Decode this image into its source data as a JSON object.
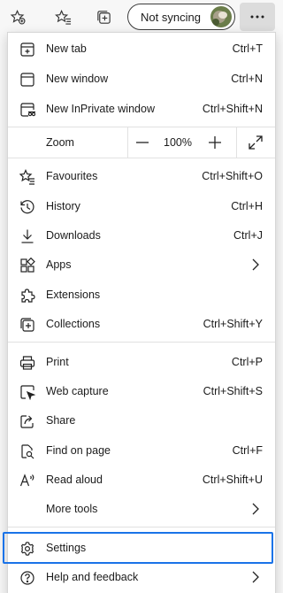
{
  "toolbar": {
    "sync_label": "Not syncing"
  },
  "menu": {
    "new_tab": {
      "label": "New tab",
      "shortcut": "Ctrl+T"
    },
    "new_window": {
      "label": "New window",
      "shortcut": "Ctrl+N"
    },
    "new_inprivate": {
      "label": "New InPrivate window",
      "shortcut": "Ctrl+Shift+N"
    },
    "zoom": {
      "label": "Zoom",
      "value": "100%"
    },
    "favourites": {
      "label": "Favourites",
      "shortcut": "Ctrl+Shift+O"
    },
    "history": {
      "label": "History",
      "shortcut": "Ctrl+H"
    },
    "downloads": {
      "label": "Downloads",
      "shortcut": "Ctrl+J"
    },
    "apps": {
      "label": "Apps"
    },
    "extensions": {
      "label": "Extensions"
    },
    "collections": {
      "label": "Collections",
      "shortcut": "Ctrl+Shift+Y"
    },
    "print": {
      "label": "Print",
      "shortcut": "Ctrl+P"
    },
    "web_capture": {
      "label": "Web capture",
      "shortcut": "Ctrl+Shift+S"
    },
    "share": {
      "label": "Share"
    },
    "find_on_page": {
      "label": "Find on page",
      "shortcut": "Ctrl+F"
    },
    "read_aloud": {
      "label": "Read aloud",
      "shortcut": "Ctrl+Shift+U"
    },
    "more_tools": {
      "label": "More tools"
    },
    "settings": {
      "label": "Settings"
    },
    "help": {
      "label": "Help and feedback"
    }
  },
  "colors": {
    "highlight": "#1a73e8",
    "more_button_bg": "#dcdcdc"
  }
}
